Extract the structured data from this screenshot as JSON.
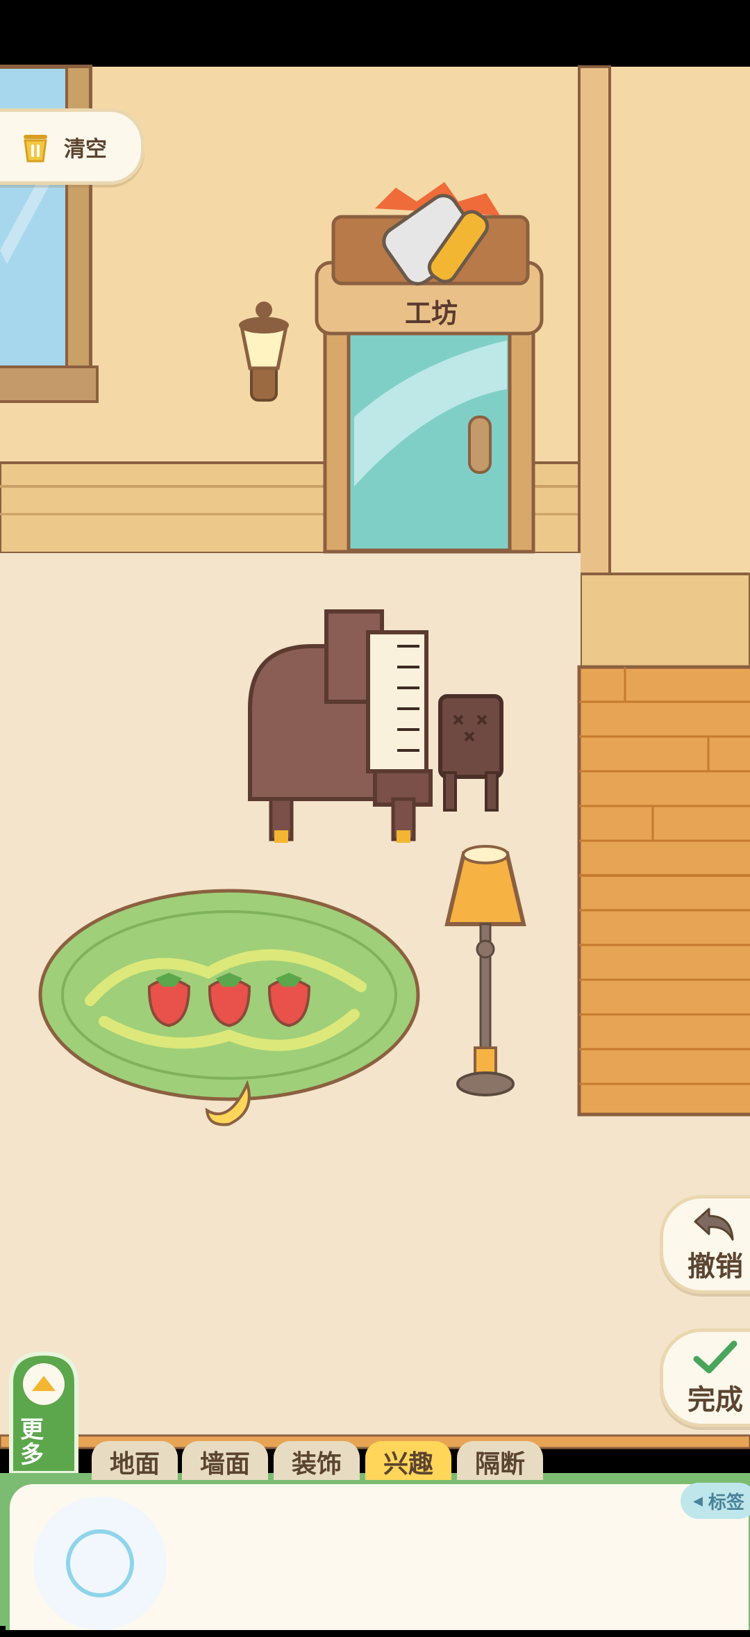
{
  "toolbar": {
    "clear_label": "清空"
  },
  "room": {
    "door_sign": "工坊"
  },
  "actions": {
    "undo_label": "撤销",
    "done_label": "完成"
  },
  "more": {
    "label": "更多"
  },
  "tabs": [
    {
      "label": "地面"
    },
    {
      "label": "墙面"
    },
    {
      "label": "装饰"
    },
    {
      "label": "兴趣",
      "active": true
    },
    {
      "label": "隔断"
    }
  ],
  "tag_button": {
    "label": "标签"
  },
  "colors": {
    "wall": "#f4d9a6",
    "floor": "#f3e4cb",
    "wood": "#e7a454",
    "rug": "#9fcf78",
    "accent": "#ffd65a"
  }
}
